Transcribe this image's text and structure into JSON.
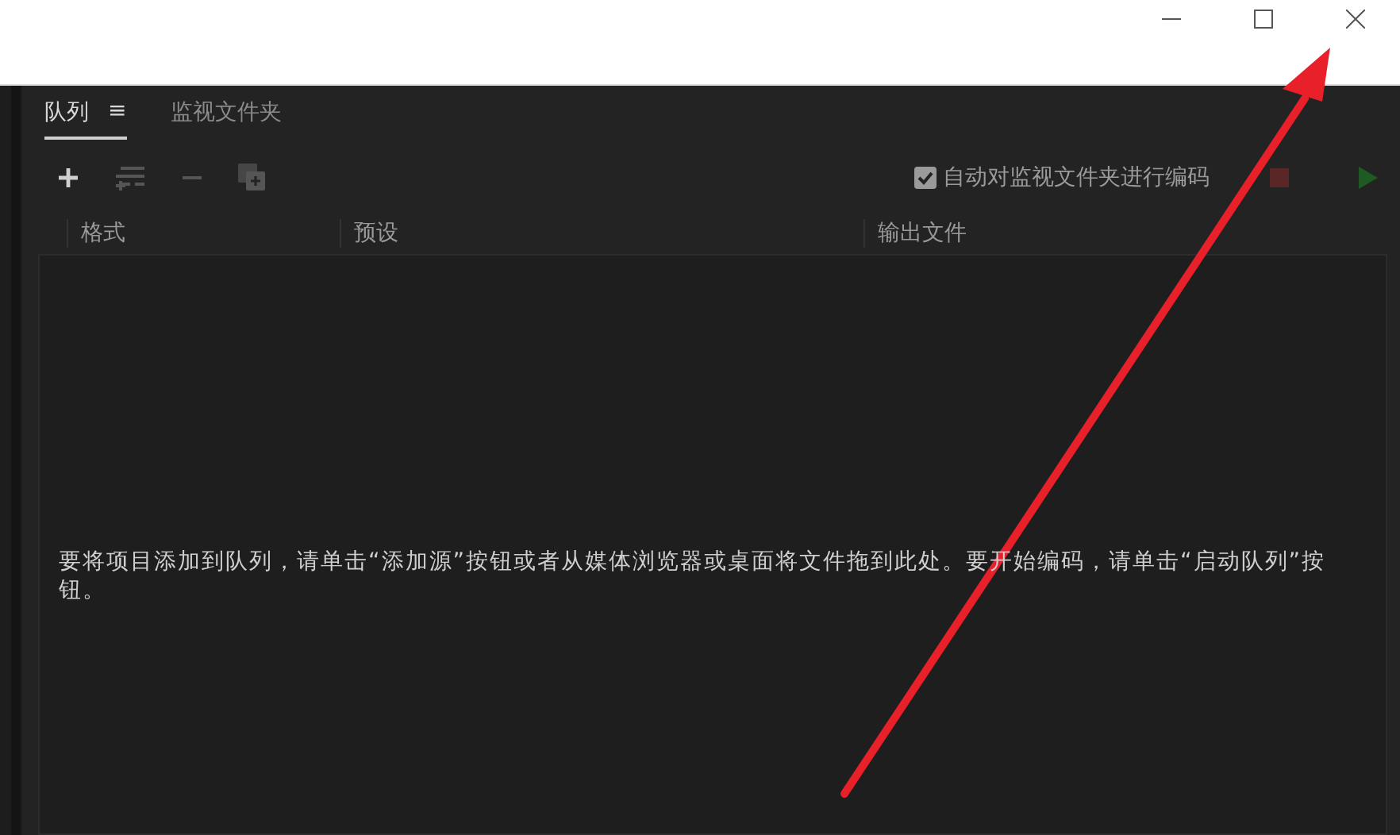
{
  "tabs": [
    {
      "label": "队列",
      "selected": true,
      "menu_icon": "≡"
    },
    {
      "label": "监视文件夹",
      "selected": false
    }
  ],
  "toolbar": {
    "buttons": [
      {
        "kind": "add",
        "disabled": false
      },
      {
        "kind": "settings",
        "disabled": true
      },
      {
        "kind": "remove",
        "disabled": true
      },
      {
        "kind": "duplicate",
        "disabled": true
      }
    ],
    "auto_encode": {
      "label": "自动对监视文件夹进行编码",
      "checked": true
    },
    "stop": {
      "disabled": true
    },
    "start": {
      "disabled": true
    }
  },
  "table": {
    "columns": [
      "格式",
      "预设",
      "输出文件"
    ],
    "empty_message": "要将项目添加到队列，请单击“添加源”按钮或者从媒体浏览器或桌面将文件拖到此处。要开始编码，请单击“启动队列”按钮。"
  }
}
